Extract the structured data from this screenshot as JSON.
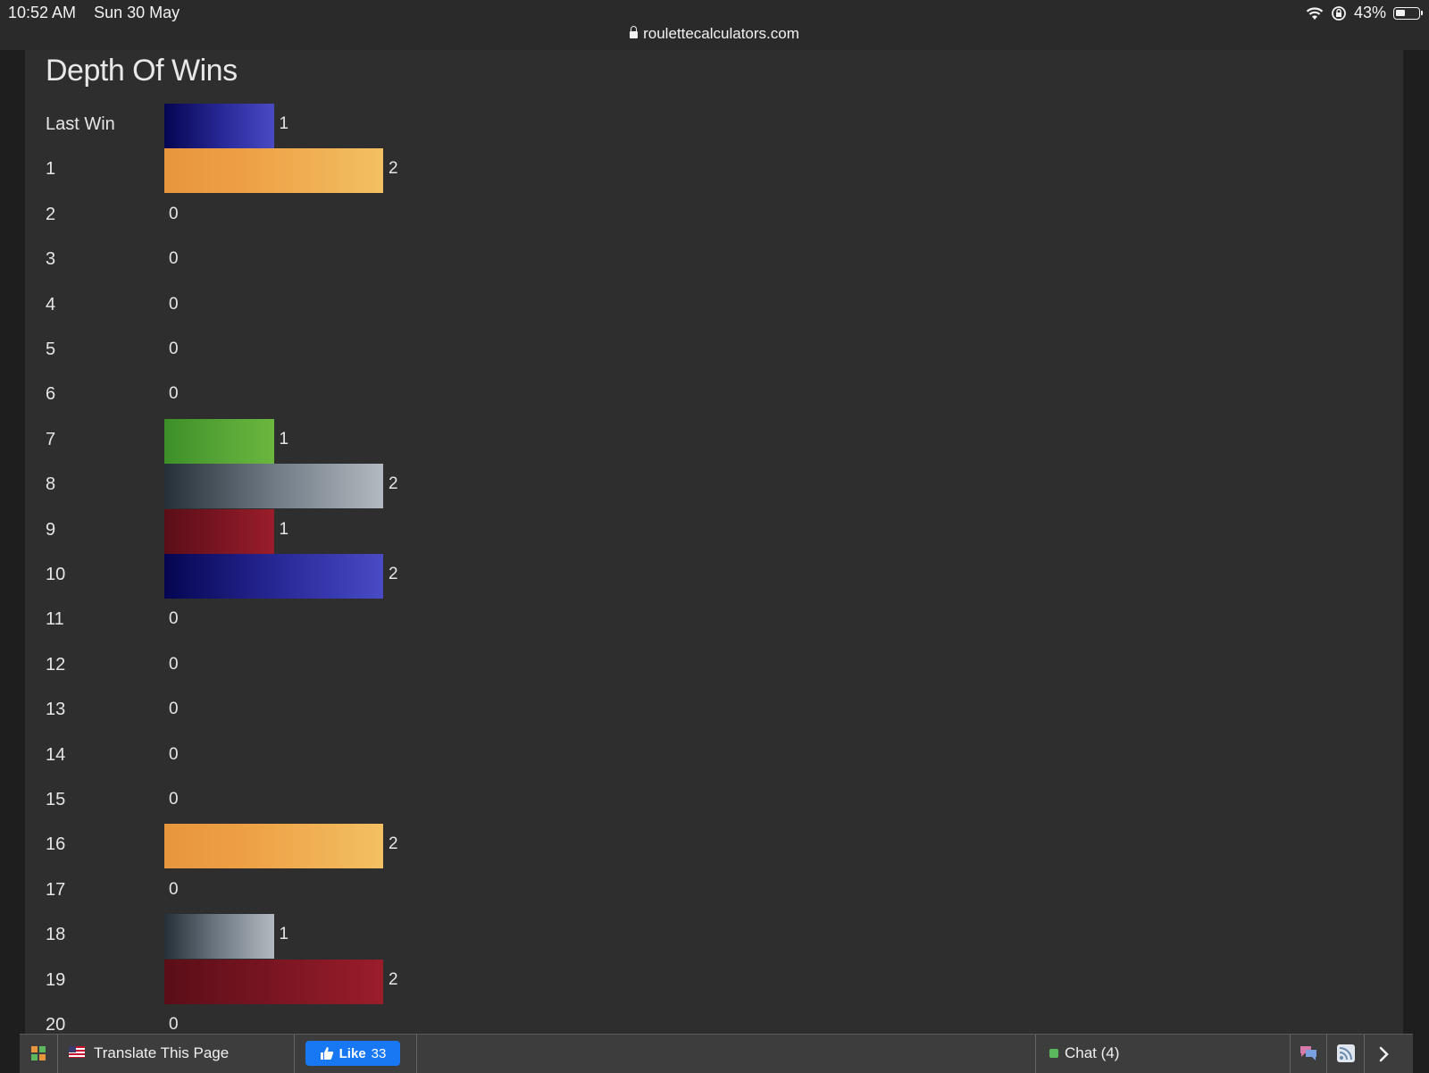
{
  "status_bar": {
    "time": "10:52 AM",
    "date": "Sun 30 May",
    "battery": "43%",
    "url": "roulettecalculators.com"
  },
  "page": {
    "title": "Depth Of Wins"
  },
  "chart_data": {
    "type": "bar",
    "orientation": "horizontal",
    "title": "Depth Of Wins",
    "categories": [
      "Last Win",
      "1",
      "2",
      "3",
      "4",
      "5",
      "6",
      "7",
      "8",
      "9",
      "10",
      "11",
      "12",
      "13",
      "14",
      "15",
      "16",
      "17",
      "18",
      "19",
      "20"
    ],
    "values": [
      1,
      2,
      0,
      0,
      0,
      0,
      0,
      1,
      2,
      1,
      2,
      0,
      0,
      0,
      0,
      0,
      2,
      0,
      1,
      2,
      0
    ],
    "bar_colors": [
      "blue",
      "orange",
      "none",
      "none",
      "none",
      "none",
      "none",
      "green",
      "gray",
      "red",
      "blue",
      "none",
      "none",
      "none",
      "none",
      "none",
      "orange",
      "none",
      "gray",
      "red",
      "none"
    ],
    "xlim": [
      0,
      2
    ]
  },
  "toolbar": {
    "translate_label": "Translate This Page",
    "like_label": "Like",
    "like_count": "33",
    "chat_label": "Chat (4)"
  }
}
